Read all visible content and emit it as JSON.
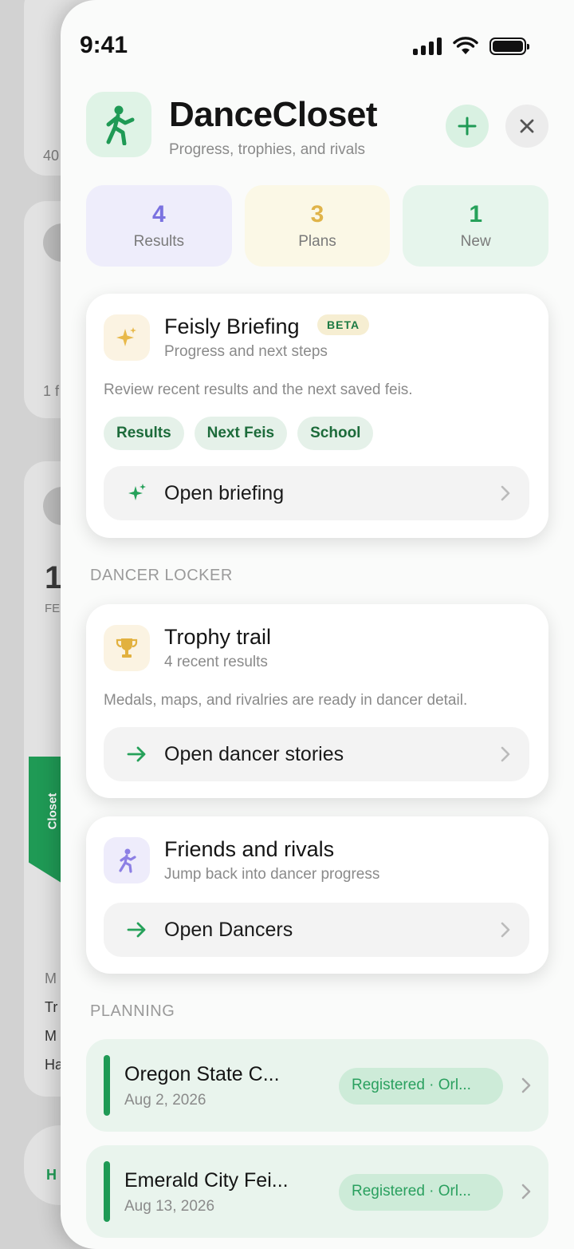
{
  "background": {
    "fragments": [
      "40",
      "1 f",
      "1",
      "FE",
      "M",
      "Tr",
      "M",
      "Ha",
      "H"
    ],
    "closet_tab": "Closet",
    "accent": "#1f9a55"
  },
  "status_bar": {
    "time": "9:41"
  },
  "header": {
    "title": "DanceCloset",
    "subtitle": "Progress, trophies, and rivals",
    "add_icon": "plus-icon",
    "close_icon": "close-icon"
  },
  "stats": [
    {
      "value": "4",
      "label": "Results",
      "color": "#7a72e0",
      "bg": "#eeedfb"
    },
    {
      "value": "3",
      "label": "Plans",
      "color": "#e0b44a",
      "bg": "#fbf8e6"
    },
    {
      "value": "1",
      "label": "New",
      "color": "#26a15a",
      "bg": "#e6f5ec"
    }
  ],
  "briefing": {
    "title": "Feisly Briefing",
    "badge": "BETA",
    "subtitle": "Progress and next steps",
    "description": "Review recent results and the next saved feis.",
    "chips": [
      "Results",
      "Next Feis",
      "School"
    ],
    "action": "Open briefing",
    "icon": "sparkles-icon"
  },
  "sections": {
    "locker": "DANCER LOCKER",
    "planning": "PLANNING"
  },
  "trophy": {
    "title": "Trophy trail",
    "subtitle": "4 recent results",
    "description": "Medals, maps, and rivalries are ready in dancer detail.",
    "action": "Open dancer stories",
    "icon": "trophy-icon"
  },
  "friends": {
    "title": "Friends and rivals",
    "subtitle": "Jump back into dancer progress",
    "action": "Open Dancers",
    "icon": "dancer-icon"
  },
  "plans": [
    {
      "title": "Oregon State C...",
      "date": "Aug 2, 2026",
      "status": "Registered · Orl..."
    },
    {
      "title": "Emerald City Fei...",
      "date": "Aug 13, 2026",
      "status": "Registered · Orl..."
    }
  ]
}
